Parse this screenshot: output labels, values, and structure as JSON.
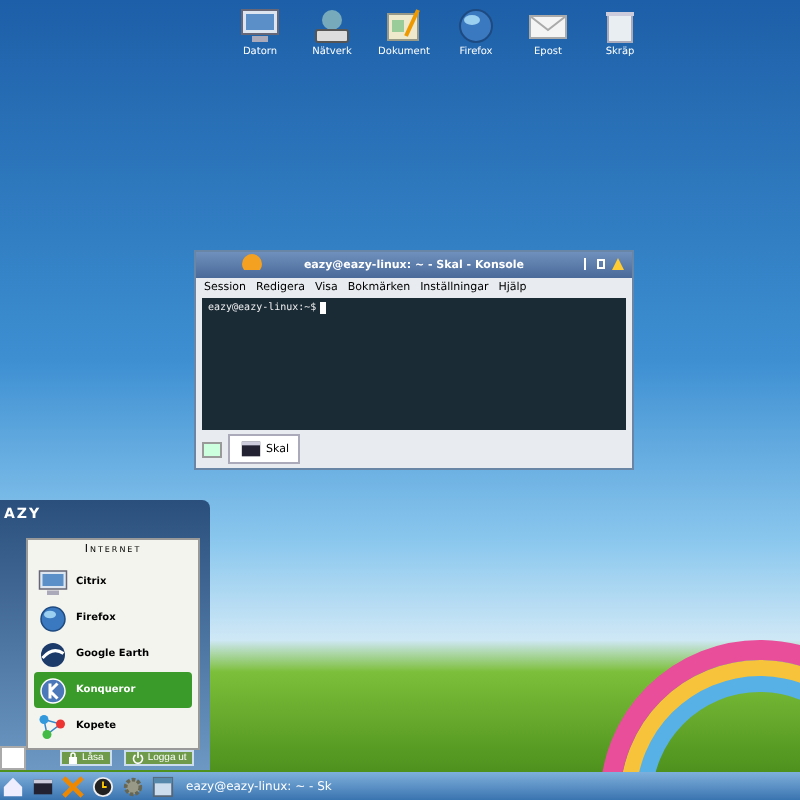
{
  "desktop_icons": [
    {
      "label": "Datorn",
      "kind": "monitor"
    },
    {
      "label": "Nätverk",
      "kind": "drive"
    },
    {
      "label": "Dokument",
      "kind": "document"
    },
    {
      "label": "Firefox",
      "kind": "globe"
    },
    {
      "label": "Epost",
      "kind": "mail"
    },
    {
      "label": "Skräp",
      "kind": "trash"
    }
  ],
  "console": {
    "title": "eazy@eazy-linux: ~ - Skal - Konsole",
    "menu": [
      "Session",
      "Redigera",
      "Visa",
      "Bokmärken",
      "Inställningar",
      "Hjälp"
    ],
    "prompt": "eazy@eazy-linux:~$",
    "tabs": [
      {
        "label": "Skal",
        "selected": true
      }
    ]
  },
  "start_menu": {
    "title": "AZY",
    "section": "Internet",
    "items": [
      {
        "label": "Citrix",
        "kind": "monitor",
        "selected": false
      },
      {
        "label": "Firefox",
        "kind": "globe",
        "selected": false
      },
      {
        "label": "Google Earth",
        "kind": "earth",
        "selected": false
      },
      {
        "label": "Konqueror",
        "kind": "k",
        "selected": true
      },
      {
        "label": "Kopete",
        "kind": "network",
        "selected": false
      }
    ],
    "buttons": [
      {
        "label": "Låsa",
        "kind": "lock"
      },
      {
        "label": "Logga ut",
        "kind": "power"
      }
    ]
  },
  "taskbar": {
    "launchers": [
      {
        "kind": "home"
      },
      {
        "kind": "terminal"
      },
      {
        "kind": "tools"
      },
      {
        "kind": "clock"
      },
      {
        "kind": "gear"
      },
      {
        "kind": "window"
      }
    ],
    "tasks": [
      {
        "label": "eazy@eazy-linux: ~ - Sk",
        "selected": false
      }
    ]
  }
}
